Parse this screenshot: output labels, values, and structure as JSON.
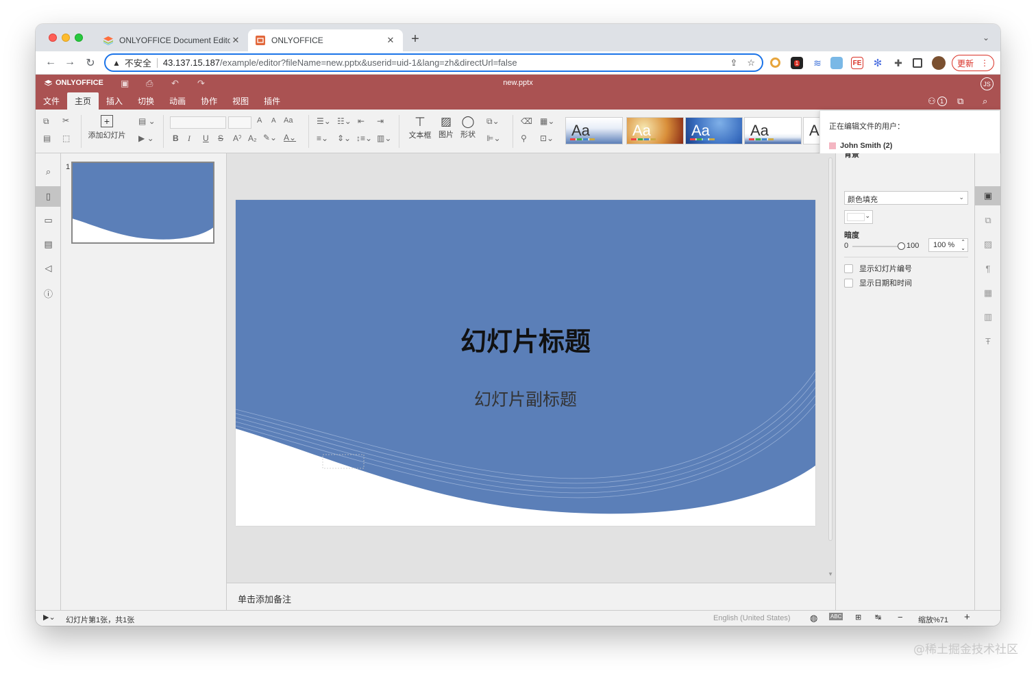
{
  "browser": {
    "tabs": [
      {
        "title": "ONLYOFFICE Document Editor",
        "active": false
      },
      {
        "title": "ONLYOFFICE",
        "active": true
      }
    ],
    "address": {
      "insecure_label": "不安全",
      "host": "43.137.15.187",
      "path": "/example/editor?fileName=new.pptx&userid=uid-1&lang=zh&directUrl=false"
    },
    "update_label": "更新",
    "extension_badge": "1"
  },
  "editor": {
    "brand": "ONLYOFFICE",
    "filename": "new.pptx",
    "avatar_initials": "JS",
    "collaborators_count": "1",
    "menu": [
      "文件",
      "主页",
      "插入",
      "切换",
      "动画",
      "协作",
      "视图",
      "插件"
    ],
    "active_menu": "主页",
    "ribbon": {
      "add_slide": "添加幻灯片",
      "textbox": "文本框",
      "image": "图片",
      "shape": "形状",
      "theme_sample": "Aa",
      "font_size_up": "A",
      "font_size_down": "A",
      "change_case": "Aa"
    },
    "users_popup": {
      "header": "正在编辑文件的用户：",
      "user": "John Smith (2)",
      "user_color": "#f4b6c2"
    },
    "thumbnails": [
      {
        "number": "1"
      }
    ],
    "slide": {
      "title": "幻灯片标题",
      "subtitle": "幻灯片副标题",
      "theme_color": "#5b7fb8"
    },
    "notes_placeholder": "单击添加备注",
    "right_panel": {
      "section_title": "背景",
      "fill_type": "颜色填充",
      "opacity_label": "暗度",
      "opacity_min": "0",
      "opacity_max": "100",
      "opacity_value": "100 %",
      "show_slide_number": "显示幻灯片编号",
      "show_date_time": "显示日期和时间"
    },
    "status": {
      "slide_info": "幻灯片第1张，共1张",
      "language": "English (United States)",
      "zoom": "缩放%71"
    }
  },
  "watermark": "@稀土掘金技术社区",
  "colors": {
    "header_bg": "#aa5252",
    "accent_blue": "#1a73e8",
    "slide_blue": "#5b7fb8"
  }
}
